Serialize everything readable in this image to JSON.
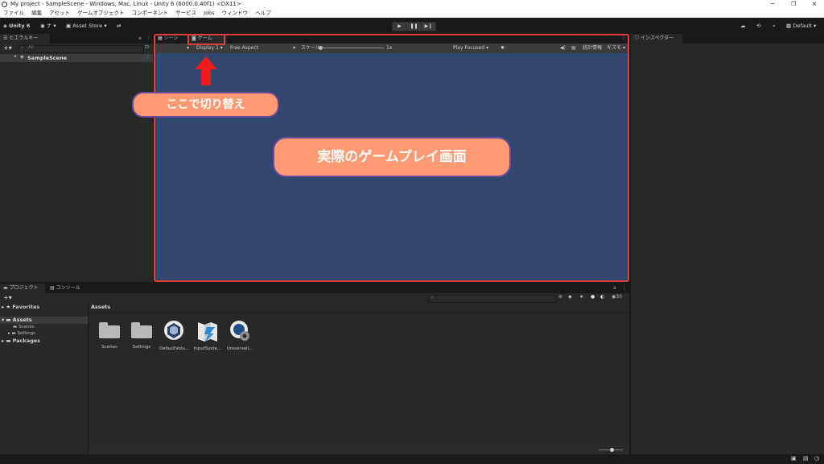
{
  "window": {
    "title": "My project - SampleScene - Windows, Mac, Linux - Unity 6 (6000.0.40f1) <DX11>"
  },
  "menu": [
    "ファイル",
    "編集",
    "アセット",
    "ゲームオブジェクト",
    "コンポーネント",
    "サービス",
    "Jobs",
    "ウィンドウ",
    "ヘルプ"
  ],
  "toolbar": {
    "unity_label": "Unity 6",
    "account_label": "ナ",
    "asset_store_label": "Asset Store",
    "layout_label": "Default",
    "play_glyph": "▶",
    "pause_glyph": "❚❚",
    "step_glyph": "▶❙"
  },
  "hierarchy": {
    "tab_label": "ヒエラルキー",
    "search_placeholder": "All",
    "scene_name": "SampleScene"
  },
  "center_tabs": {
    "scene_label": "シーン",
    "game_label": "ゲーム"
  },
  "game_toolbar": {
    "display": "Display 1",
    "aspect": "Free Aspect",
    "scale_label": "スケール",
    "scale_value": "1x",
    "play_mode": "Play Focused",
    "stats_label": "統計情報",
    "gizmos_label": "ギズモ"
  },
  "inspector": {
    "tab_label": "インスペクター"
  },
  "callouts": {
    "switch_here": "ここで切り替え",
    "game_view": "実際のゲームプレイ画面"
  },
  "project": {
    "tab_project": "プロジェクト",
    "tab_console": "コンソール",
    "favorites": "Favorites",
    "assets": "Assets",
    "scenes": "Scenes",
    "settings": "Settings",
    "packages": "Packages",
    "breadcrumb": "Assets",
    "count_badge": "30",
    "items": [
      {
        "label": "Scenes"
      },
      {
        "label": "Settings"
      },
      {
        "label": "DefaultVolu..."
      },
      {
        "label": "InputSyste..."
      },
      {
        "label": "Universall..."
      }
    ]
  },
  "colors": {
    "game_background": "#31476d",
    "highlight_red": "#e43b3b",
    "callout_fill": "#ff9a73",
    "callout_border": "#6b4a9c"
  }
}
